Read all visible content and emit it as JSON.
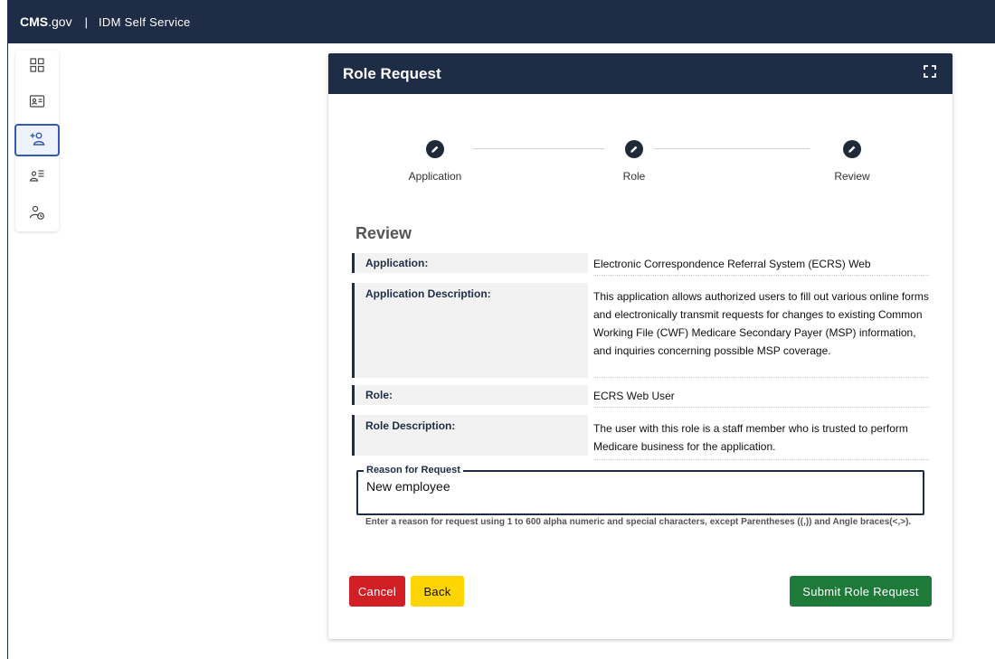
{
  "topbar": {
    "brand_strong": "CMS",
    "brand_rest": ".gov",
    "separator": "|",
    "app_name": "IDM Self Service"
  },
  "sidebar": {
    "items": [
      {
        "icon": "dashboard-grid-icon"
      },
      {
        "icon": "id-card-icon"
      },
      {
        "icon": "add-person-icon",
        "active": true
      },
      {
        "icon": "person-list-icon"
      },
      {
        "icon": "person-clock-icon"
      }
    ]
  },
  "card": {
    "title": "Role Request",
    "expand_icon": "fullscreen-icon"
  },
  "stepper": {
    "steps": [
      {
        "label": "Application",
        "icon": "pencil-icon"
      },
      {
        "label": "Role",
        "icon": "pencil-icon"
      },
      {
        "label": "Review",
        "icon": "pencil-icon"
      }
    ]
  },
  "review": {
    "heading": "Review",
    "rows": [
      {
        "label": "Application:",
        "value": "Electronic Correspondence Referral System (ECRS) Web"
      },
      {
        "label": "Application Description:",
        "value": "This application allows authorized users to fill out various online forms and electronically transmit requests for changes to existing Common Working File (CWF) Medicare Secondary Payer (MSP) information, and inquiries concerning possible MSP coverage."
      },
      {
        "label": "Role:",
        "value": "ECRS Web User"
      },
      {
        "label": "Role Description:",
        "value": "The user with this role is a staff member who is trusted to perform Medicare business for the application."
      }
    ]
  },
  "reason": {
    "label": "Reason for Request",
    "value": "New employee",
    "helper": "Enter a reason for request using 1 to 600 alpha numeric and special characters, except Parentheses ((,)) and Angle braces(<,>)."
  },
  "buttons": {
    "cancel": "Cancel",
    "back": "Back",
    "submit": "Submit Role Request"
  },
  "colors": {
    "navy": "#1e2d45",
    "cancel": "#d11f25",
    "back": "#ffd400",
    "submit": "#1f7a3a",
    "active_accent": "#3559b5"
  }
}
